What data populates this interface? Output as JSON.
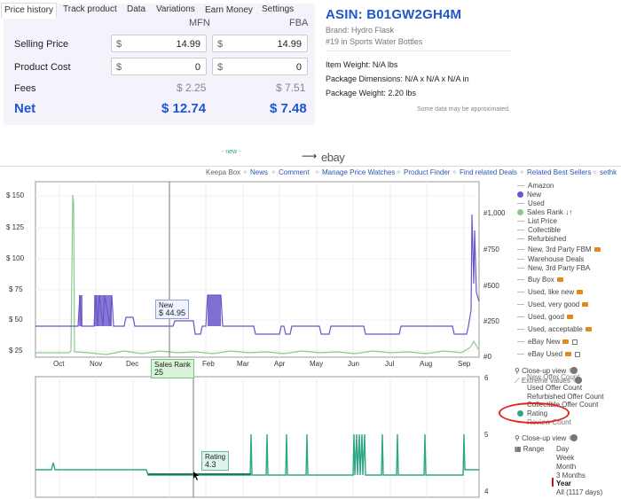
{
  "calculator": {
    "col_mfn": "MFN",
    "col_fba": "FBA",
    "rows": {
      "selling_price": {
        "label": "Selling Price",
        "currency": "$",
        "mfn": "14.99",
        "fba": "14.99"
      },
      "product_cost": {
        "label": "Product Cost",
        "currency": "$",
        "mfn": "0",
        "fba": "0"
      },
      "fees": {
        "label": "Fees",
        "mfn": "$ 2.25",
        "fba": "$ 7.51"
      },
      "net": {
        "label": "Net",
        "mfn": "$ 12.74",
        "fba": "$ 7.48"
      }
    }
  },
  "product": {
    "asin": "ASIN: B01GW2GH4M",
    "brand": "Brand: Hydro Flask",
    "rank": "#19 in Sports Water Bottles",
    "item_weight": "Item Weight: N/A lbs",
    "package_dimensions": "Package Dimensions: N/A x N/A x N/A in",
    "package_weight": "Package Weight: 2.20 lbs",
    "approx_note": "Some data may be approximated."
  },
  "tabs": {
    "price_history": "Price history",
    "track_product": "Track product",
    "data": "Data",
    "variations": "Variations",
    "earn_money": "Earn Money",
    "earn_money_tag": "- new -",
    "settings": "Settings",
    "arrow": "⟶",
    "ebay": "ebay"
  },
  "linkbar": {
    "keepa_box": "Keepa Box",
    "news": "News",
    "comment": "Comment",
    "manage_watches": "Manage Price Watches",
    "product_finder": "Product Finder",
    "related_deals": "Find related Deals",
    "related_sellers": "Related Best Sellers",
    "user": "sethk"
  },
  "price_chart": {
    "y_left": [
      "$ 150",
      "$ 125",
      "$ 100",
      "$ 75",
      "$ 50",
      "$ 25"
    ],
    "y_right": [
      "#1,000",
      "#750",
      "#500",
      "#250",
      "#0"
    ],
    "x_labels": [
      "Oct",
      "Nov",
      "Dec",
      "Jan",
      "Feb",
      "Mar",
      "Apr",
      "May",
      "Jun",
      "Jul",
      "Aug",
      "Sep"
    ],
    "tooltip_new_title": "New",
    "tooltip_new_value": "$ 44.95",
    "tooltip_rank_title": "Sales Rank",
    "tooltip_rank_value": "25"
  },
  "rating_chart": {
    "y_right": [
      "6",
      "5",
      "4"
    ],
    "tooltip_title": "Rating",
    "tooltip_value": "4.3"
  },
  "legend": {
    "amazon": "Amazon",
    "new": "New",
    "used": "Used",
    "sales_rank": "Sales Rank",
    "sales_rank_icon": "↓↑",
    "list_price": "List Price",
    "collectible": "Collectible",
    "refurbished": "Refurbished",
    "new_3p_fbm": "New, 3rd Party FBM",
    "warehouse_deals": "Warehouse Deals",
    "new_3p_fba": "New, 3rd Party FBA",
    "buy_box": "Buy Box",
    "used_like_new": "Used, like new",
    "used_very_good": "Used, very good",
    "used_good": "Used, good",
    "used_acceptable": "Used, acceptable",
    "ebay_new": "eBay New",
    "ebay_used": "eBay Used",
    "closeup_1": "Close-up view",
    "new_offer_count": "New Offer Count",
    "extreme_values": "Extreme values",
    "used_offer_count": "Used Offer Count",
    "refurbished_offer_count": "Refurbished Offer Count",
    "collectible_offer_count": "Collectible Offer Count",
    "rating": "Rating",
    "review_count": "Review Count",
    "closeup_2": "Close-up view",
    "range_label": "Range",
    "range_day": "Day",
    "range_week": "Week",
    "range_month": "Month",
    "range_3months": "3 Months",
    "range_year": "Year",
    "range_all": "All (1117 days)"
  },
  "colors": {
    "accent_blue": "#1b56d6",
    "new_series": "#6a55c9",
    "sales_rank_series": "#8cc98c",
    "rating_series": "#2fa588",
    "highlight_ring": "#e1241e"
  }
}
